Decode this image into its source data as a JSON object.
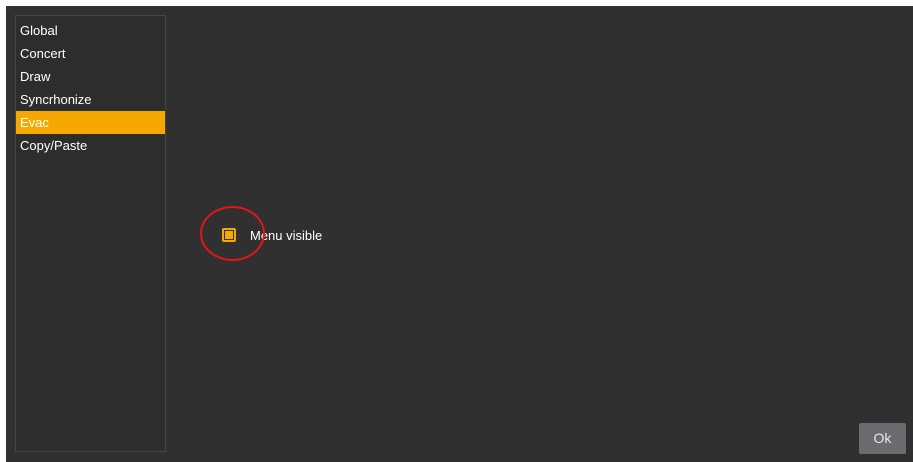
{
  "sidebar": {
    "items": [
      {
        "label": "Global",
        "active": false
      },
      {
        "label": "Concert",
        "active": false
      },
      {
        "label": "Draw",
        "active": false
      },
      {
        "label": "Syncrhonize",
        "active": false
      },
      {
        "label": "Evac",
        "active": true
      },
      {
        "label": "Copy/Paste",
        "active": false
      }
    ]
  },
  "evac": {
    "menu_visible_label": "Menu visible",
    "menu_visible_checked": true
  },
  "footer": {
    "ok_label": "Ok"
  },
  "colors": {
    "accent": "#f7a800",
    "background": "#303030",
    "annotation": "#e41515",
    "button": "#6b6b70"
  }
}
